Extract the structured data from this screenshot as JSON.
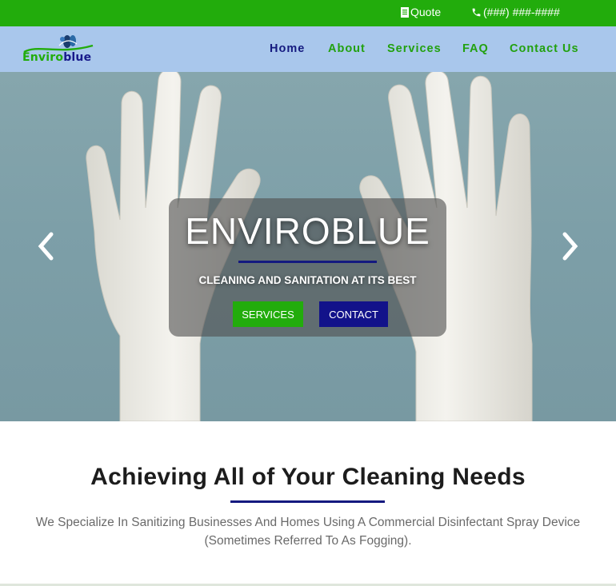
{
  "topbar": {
    "quote_label": "Quote",
    "phone_label": "(###) ###-####",
    "quote_icon": "document-icon",
    "phone_icon": "phone-icon"
  },
  "brand": {
    "logo_part1": "Enviro",
    "logo_part2": "blue"
  },
  "nav": {
    "items": [
      {
        "label": "Home",
        "active": true
      },
      {
        "label": "About"
      },
      {
        "label": "Services"
      },
      {
        "label": "FAQ"
      },
      {
        "label": "Contact Us"
      }
    ]
  },
  "hero": {
    "title": "ENVIROBLUE",
    "subtitle": "CLEANING AND SANITATION AT ITS BEST",
    "services_button": "SERVICES",
    "contact_button": "CONTACT",
    "prev_icon": "chevron-left-icon",
    "next_icon": "chevron-right-icon"
  },
  "intro": {
    "heading": "Achieving All of Your Cleaning Needs",
    "text": "We Specialize In Sanitizing Businesses And Homes Using A Commercial Disinfectant Spray Device (Sometimes Referred To As Fogging)."
  },
  "colors": {
    "green": "#22ac0c",
    "navy": "#14197f",
    "nav_bg": "#a9c7ec"
  }
}
